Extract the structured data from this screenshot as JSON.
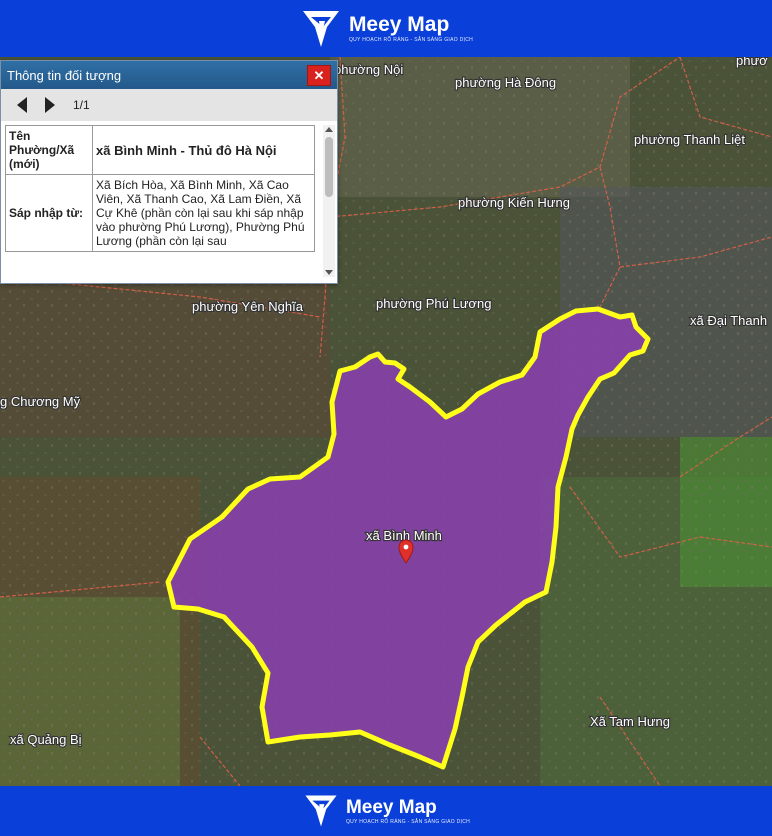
{
  "brand": {
    "name": "Meey Map",
    "tagline": "QUY HOẠCH RÕ RÀNG - SẴN SÀNG GIAO DỊCH"
  },
  "panel": {
    "title": "Thông tin đối tượng",
    "pager": "1/1",
    "rows": [
      {
        "key": "Tên Phường/Xã (mới)",
        "value": "xã Bình Minh - Thủ đô Hà Nội"
      },
      {
        "key": "Sáp nhập từ:",
        "value": "Xã Bích Hòa, Xã Bình Minh, Xã Cao Viên, Xã Thanh Cao, Xã Lam Điền, Xã Cự Khê (phần còn lại sau khi sáp nhập vào phường Phú Lương), Phường Phú Lương (phần còn lại sau"
      }
    ]
  },
  "map": {
    "labels": {
      "hanoi": "phường Nội",
      "hadong": "phường Hà Đông",
      "thanhliet": "phường Thanh Liệt",
      "kienhung": "phường Kiến Hưng",
      "yennghia": "phường Yên Nghĩa",
      "phuluong": "phường Phú Lương",
      "daithanh": "xã Đại Thanh",
      "chuongmy": "g Chương Mỹ",
      "binhminh": "xã Bình Minh",
      "tamhung": "Xã Tam Hưng",
      "quangbi": "xã Quảng Bị",
      "topright": "phườ"
    },
    "colors": {
      "highlight_fill": "#8a3fb0",
      "highlight_stroke": "#ffff1a",
      "boundary": "#e0604a",
      "marker": "#e0302a"
    }
  }
}
